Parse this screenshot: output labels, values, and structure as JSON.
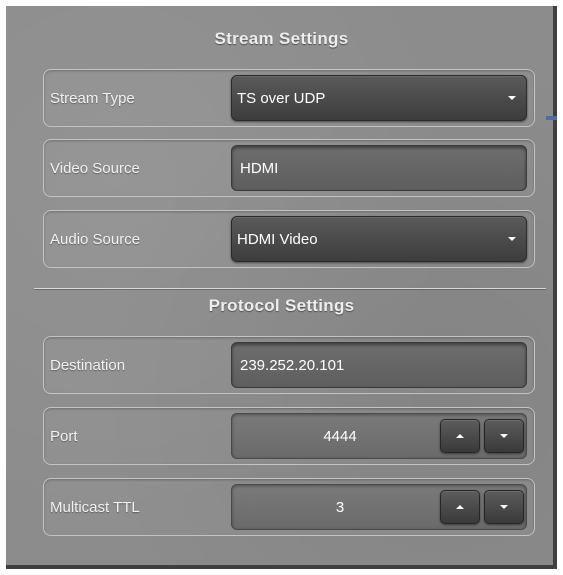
{
  "stream_settings": {
    "title": "Stream Settings",
    "stream_type": {
      "label": "Stream Type",
      "value": "TS over UDP"
    },
    "video_source": {
      "label": "Video Source",
      "value": "HDMI"
    },
    "audio_source": {
      "label": "Audio Source",
      "value": "HDMI Video"
    }
  },
  "protocol_settings": {
    "title": "Protocol Settings",
    "destination": {
      "label": "Destination",
      "value": "239.252.20.101"
    },
    "port": {
      "label": "Port",
      "value": "4444"
    },
    "multicast_ttl": {
      "label": "Multicast TTL",
      "value": "3"
    }
  },
  "icons": {
    "dropdown": "chevron-down-icon",
    "increment": "caret-up-icon",
    "decrement": "caret-down-icon"
  },
  "colors": {
    "panel_bg": "#8c8c8c",
    "control_dark": "#4a4a4a",
    "accent": "#4a6fa8",
    "text": "#ffffff"
  }
}
